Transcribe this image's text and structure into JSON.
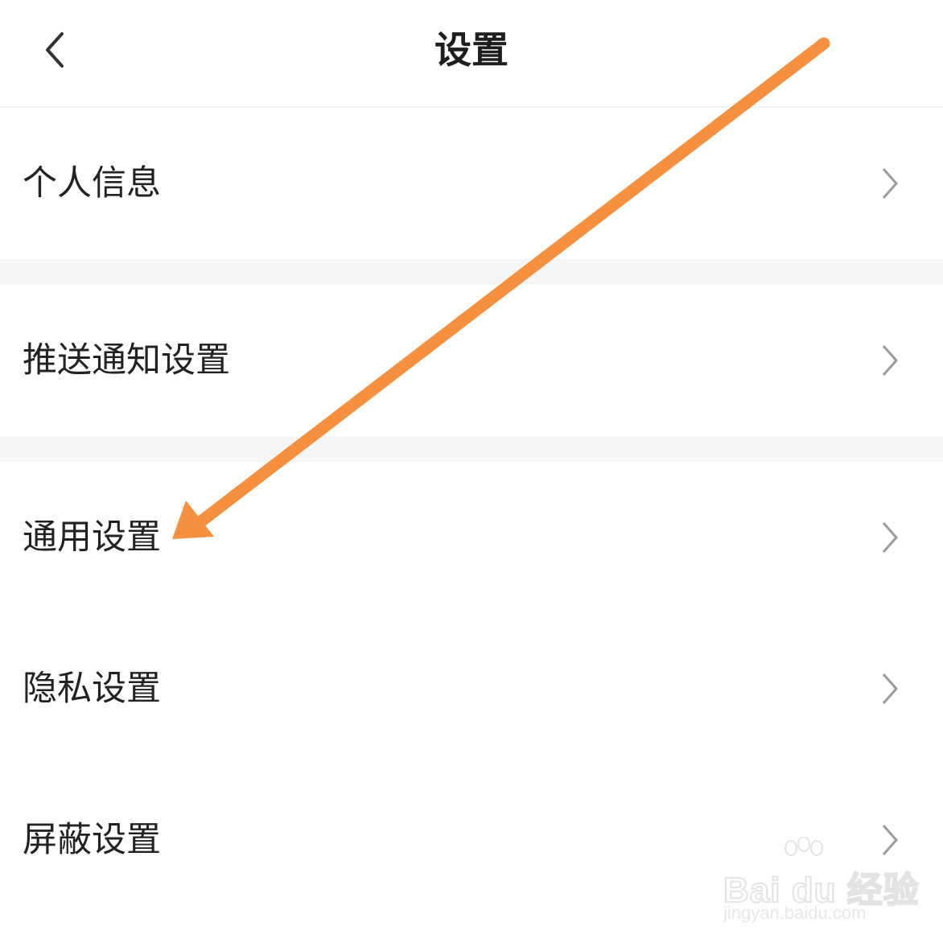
{
  "header": {
    "title": "设置"
  },
  "settings": {
    "items": [
      {
        "label": "个人信息"
      },
      {
        "label": "推送通知设置"
      },
      {
        "label": "通用设置"
      },
      {
        "label": "隐私设置"
      },
      {
        "label": "屏蔽设置"
      }
    ]
  },
  "annotation": {
    "arrow_color": "#f7903e",
    "pointing_to": "通用设置"
  },
  "watermark": {
    "logo_text": "Bai du 经验",
    "url_text": "jingyan.baidu.com"
  },
  "colors": {
    "background": "#ffffff",
    "section_gap": "#f6f6f6",
    "text": "#222222",
    "chevron": "#9a9a9a"
  }
}
